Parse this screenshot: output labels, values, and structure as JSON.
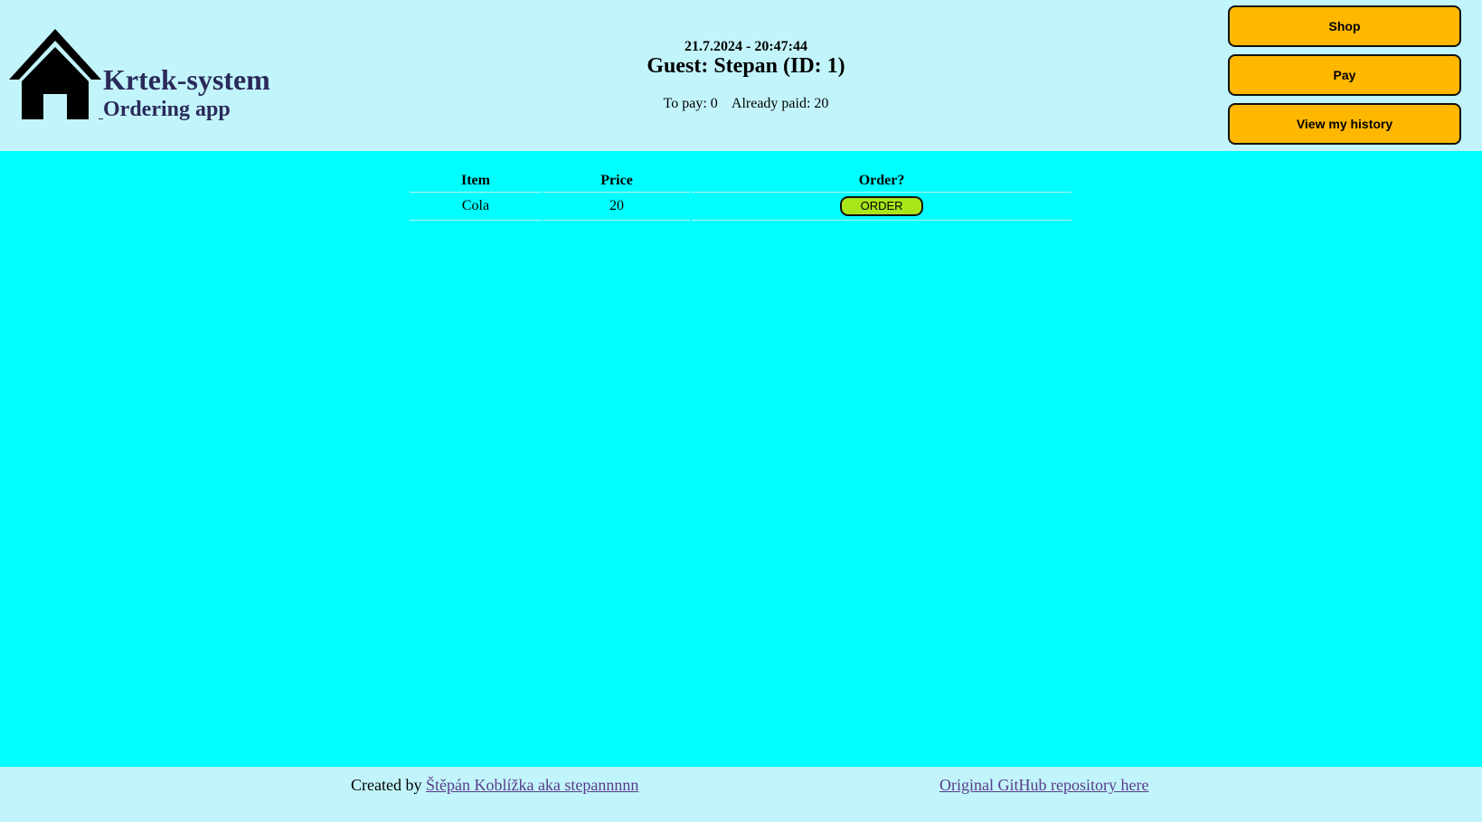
{
  "header": {
    "brand_title": "Krtek-system",
    "brand_subtitle": "Ordering app",
    "datetime": "21.7.2024 - 20:47:44",
    "guest": "Guest: Stepan (ID: 1)",
    "to_pay_label": "To pay:",
    "to_pay_value": "0",
    "already_paid_label": "Already paid:",
    "already_paid_value": "20"
  },
  "nav": {
    "shop": "Shop",
    "pay": "Pay",
    "history": "View my history"
  },
  "menu_table": {
    "columns": [
      "Item",
      "Price",
      "Order?"
    ],
    "rows": [
      {
        "item": "Cola",
        "price": "20",
        "action": "ORDER"
      }
    ]
  },
  "footer": {
    "created_by": "Created by",
    "author_link": "Štěpán Koblížka aka stepannnnn ",
    "repo_link": "Original GitHub repository here"
  },
  "colors": {
    "page_background": "#00ffff",
    "header_background": "#c2f5fb",
    "nav_button": "#ffb700",
    "order_button": "#a8e61a",
    "brand_text": "#2a2a5a",
    "link": "#5a3a8a"
  },
  "icons": {
    "logo": "home-icon"
  }
}
